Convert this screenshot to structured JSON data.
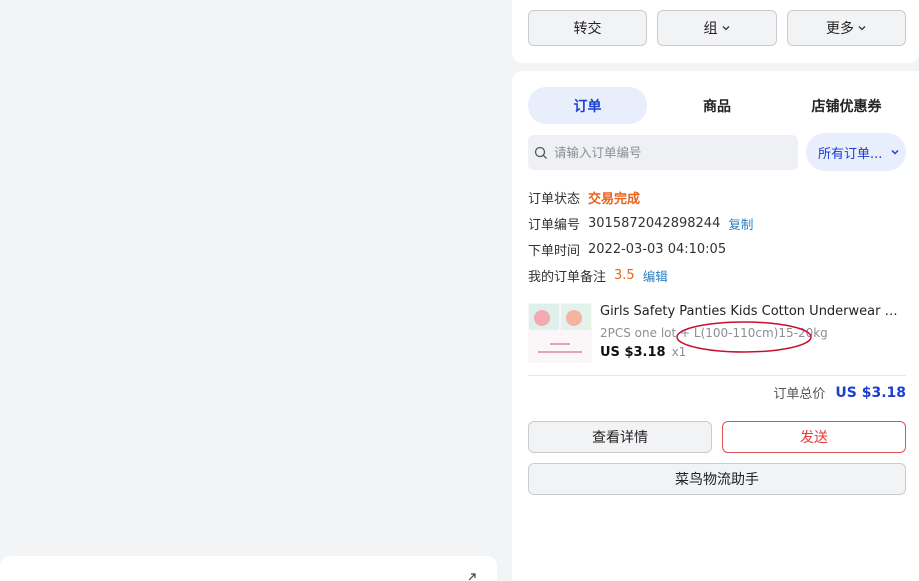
{
  "top_actions": {
    "transfer_label": "转交",
    "group_label": "组",
    "more_label": "更多"
  },
  "tabs": [
    {
      "label": "订单",
      "active": true
    },
    {
      "label": "商品",
      "active": false
    },
    {
      "label": "店铺优惠券",
      "active": false
    }
  ],
  "search": {
    "placeholder": "请输入订单编号",
    "icon": "search-icon"
  },
  "filter": {
    "selected": "所有订单..."
  },
  "order": {
    "status_label": "订单状态",
    "status_value": "交易完成",
    "number_label": "订单编号",
    "number_value": "3015872042898244",
    "copy_label": "复制",
    "time_label": "下单时间",
    "time_value": "2022-03-03 04:10:05",
    "note_label": "我的订单备注",
    "note_value": "3.5",
    "edit_label": "编辑"
  },
  "product": {
    "title": "Girls Safety Panties Kids Cotton Underwear Children",
    "variant": "2PCS one lot + L(100-110cm)15-20kg",
    "price": "US $3.18",
    "quantity": "x1"
  },
  "total": {
    "label": "订单总价",
    "amount": "US $3.18"
  },
  "actions": {
    "details_label": "查看详情",
    "send_label": "发送",
    "logistics_label": "菜鸟物流助手"
  },
  "colors": {
    "accent": "#1a3fd1",
    "status": "#e8631c",
    "send_red": "#e03b3b",
    "annotation_red": "#c8102e"
  }
}
